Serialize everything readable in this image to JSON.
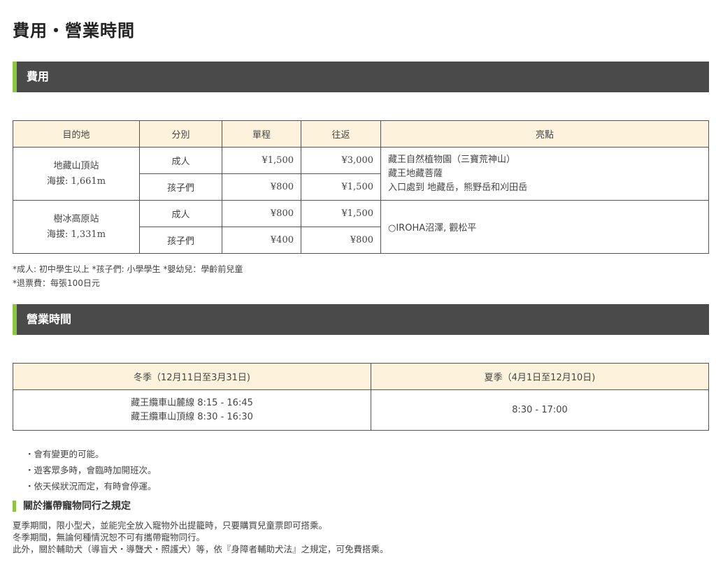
{
  "page_title": "費用・營業時間",
  "fee_section": {
    "title": "費用",
    "headers": [
      "目的地",
      "分別",
      "單程",
      "往返",
      "亮點"
    ],
    "stations": [
      {
        "name": "地藏山頂站",
        "altitude": "海拔: 1,661m",
        "rows": [
          {
            "type": "成人",
            "one_way": "¥1,500",
            "round_trip": "¥3,000"
          },
          {
            "type": "孩子們",
            "one_way": "¥800",
            "round_trip": "¥1,500"
          }
        ],
        "highlights": [
          "藏王自然植物園（三寶荒神山）",
          "藏王地藏菩薩",
          "入口處到 地藏岳，熊野岳和刈田岳"
        ]
      },
      {
        "name": "樹冰高原站",
        "altitude": "海拔: 1,331m",
        "rows": [
          {
            "type": "成人",
            "one_way": "¥800",
            "round_trip": "¥1,500"
          },
          {
            "type": "孩子們",
            "one_way": "¥400",
            "round_trip": "¥800"
          }
        ],
        "highlights": [
          "○IROHA沼澤, 觀松平"
        ]
      }
    ],
    "notes": [
      "*成人: 初中學生以上 *孩子們: 小學學生 *嬰幼兒：學齡前兒童",
      "*退票費：每張100日元"
    ]
  },
  "hours_section": {
    "title": "營業時間",
    "winter_header": "冬季（12月11日至3月31日)",
    "summer_header": "夏季（4月1日至12月10日)",
    "winter_lines": [
      "藏王纜車山麓線 8:15 - 16:45",
      "藏王纜車山頂線 8:30 - 16:30"
    ],
    "summer_hours": "8:30 - 17:00",
    "bullets": [
      "・會有變更的可能。",
      "・遊客眾多時，會臨時加開班次。",
      "・依天候狀況而定，有時會停運。"
    ]
  },
  "pet_section": {
    "title": "關於攜帶寵物同行之規定",
    "lines": [
      "夏季期間，限小型犬，並能完全放入寵物外出提籠時，只要購買兒童票即可搭乘。",
      "冬季期間，無論何種情況恕不可有攜帶寵物同行。",
      "此外，關於輔助犬（導盲犬・導聾犬・照護犬）等，依『身障者輔助犬法』之規定，可免費搭乘。"
    ]
  },
  "colors": {
    "header_bar": "#4a4a4a",
    "accent": "#8cc63f",
    "table_header": "#fdf3dc"
  }
}
